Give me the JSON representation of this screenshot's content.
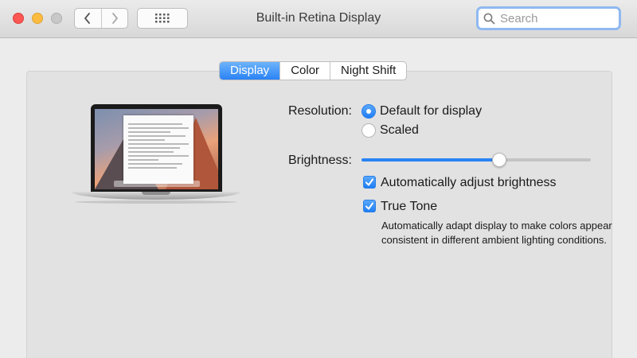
{
  "window": {
    "title": "Built-in Retina Display"
  },
  "toolbar": {
    "back_icon": "chevron-left-icon",
    "forward_icon": "chevron-right-icon",
    "show_all_icon": "grid-icon"
  },
  "search": {
    "placeholder": "Search",
    "icon": "search-icon"
  },
  "tabs": [
    {
      "label": "Display",
      "active": true
    },
    {
      "label": "Color",
      "active": false
    },
    {
      "label": "Night Shift",
      "active": false
    }
  ],
  "resolution": {
    "label": "Resolution:",
    "options": [
      {
        "label": "Default for display",
        "selected": true
      },
      {
        "label": "Scaled",
        "selected": false
      }
    ]
  },
  "brightness": {
    "label": "Brightness:",
    "level": 0.6
  },
  "auto_brightness": {
    "label": "Automatically adjust brightness",
    "checked": true
  },
  "true_tone": {
    "label": "True Tone",
    "checked": true,
    "description": "Automatically adapt display to make colors appear consistent in different ambient lighting conditions."
  },
  "colors": {
    "accent": "#2a83f5",
    "close": "#fc5753",
    "minimize": "#fdbc40"
  }
}
